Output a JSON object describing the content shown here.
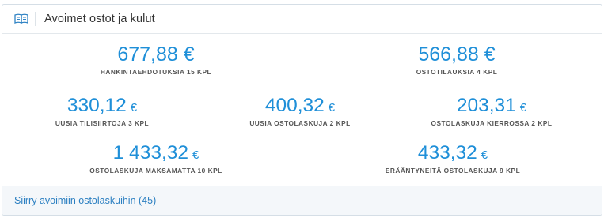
{
  "header": {
    "title": "Avoimet ostot ja kulut",
    "icon": "book-icon"
  },
  "accent_color": "#1f8fd8",
  "currency": "€",
  "stats": {
    "purchase_proposals": {
      "value": "677,88",
      "label": "HANKINTAEHDOTUKSIA 15 KPL"
    },
    "purchase_orders": {
      "value": "566,88",
      "label": "OSTOTILAUKSIA 4 KPL"
    },
    "new_transfers": {
      "value": "330,12",
      "label": "UUSIA TILISIIRTOJA 3 KPL"
    },
    "new_invoices": {
      "value": "400,32",
      "label": "UUSIA OSTOLASKUJA 2 KPL"
    },
    "invoices_in_circulation": {
      "value": "203,31",
      "label": "OSTOLASKUJA KIERROSSA 2 KPL"
    },
    "unpaid_invoices": {
      "value": "1 433,32",
      "label": "OSTOLASKUJA MAKSAMATTA 10 KPL"
    },
    "overdue_invoices": {
      "value": "433,32",
      "label": "ERÄÄNTYNEITÄ OSTOLASKUJA 9 KPL"
    }
  },
  "footer": {
    "link": "Siirry avoimiin ostolaskuihin (45)"
  }
}
